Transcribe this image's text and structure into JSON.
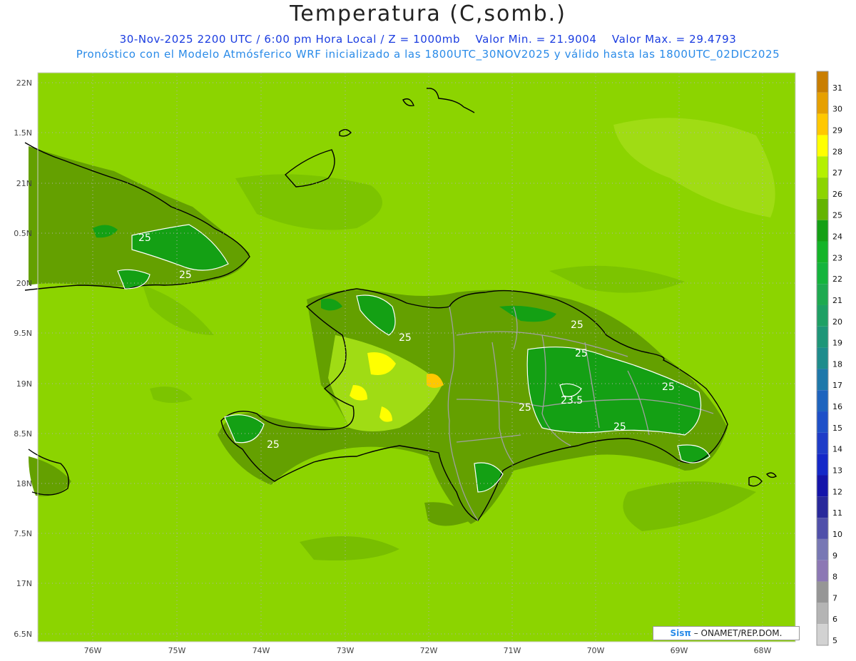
{
  "header": {
    "title": "Temperatura (C,somb.)",
    "line1_date": "30-Nov-2025  2200 UTC / 6:00 pm Hora Local / Z = 1000mb",
    "line1_min": "Valor Min. = 21.9004",
    "line1_max": "Valor Max. = 29.4793",
    "line2": "Pronóstico con el Modelo Atmósferico WRF inicializado a las 1800UTC_30NOV2025 y válido hasta las  1800UTC_02DIC2025"
  },
  "axes": {
    "lat_labels": [
      "22N",
      "1.5N",
      "21N",
      "0.5N",
      "20N",
      "9.5N",
      "19N",
      "8.5N",
      "18N",
      "7.5N",
      "17N",
      "6.5N"
    ],
    "lon_labels": [
      "76W",
      "75W",
      "74W",
      "73W",
      "72W",
      "71W",
      "70W",
      "69W",
      "68W"
    ]
  },
  "contour_labels": [
    "25",
    "25",
    "25",
    "25",
    "25",
    "25",
    "25",
    "25",
    "23.5"
  ],
  "colorbar": {
    "levels": [
      "31",
      "30",
      "29",
      "28",
      "27",
      "26",
      "25",
      "24",
      "23",
      "22",
      "21",
      "20",
      "19",
      "18",
      "17",
      "16",
      "15",
      "14",
      "13",
      "12",
      "11",
      "10",
      "9",
      "8",
      "7",
      "6",
      "5"
    ],
    "colors": [
      "#c97e00",
      "#e6a000",
      "#ffc800",
      "#ffff00",
      "#b4f000",
      "#8cd400",
      "#64b400",
      "#14a014",
      "#14b428",
      "#14b43c",
      "#1eaa50",
      "#1ea064",
      "#1e9678",
      "#1e8c8c",
      "#1e78aa",
      "#1e64be",
      "#1e50c8",
      "#1e3cc8",
      "#1428c8",
      "#1414aa",
      "#28289b",
      "#5050aa",
      "#7878b4",
      "#8c78b4",
      "#969696",
      "#b4b4b4",
      "#d2d2d2"
    ]
  },
  "credit": {
    "sis": "Sisπ",
    "text": " – ONAMET/REP.DOM."
  },
  "palette": {
    "sea_light": "#8cd400",
    "land_mid": "#64a000",
    "warm_core": "#ffff00",
    "cool_core": "#14a014",
    "coast": "#000000",
    "border": "#a0a0a0"
  }
}
